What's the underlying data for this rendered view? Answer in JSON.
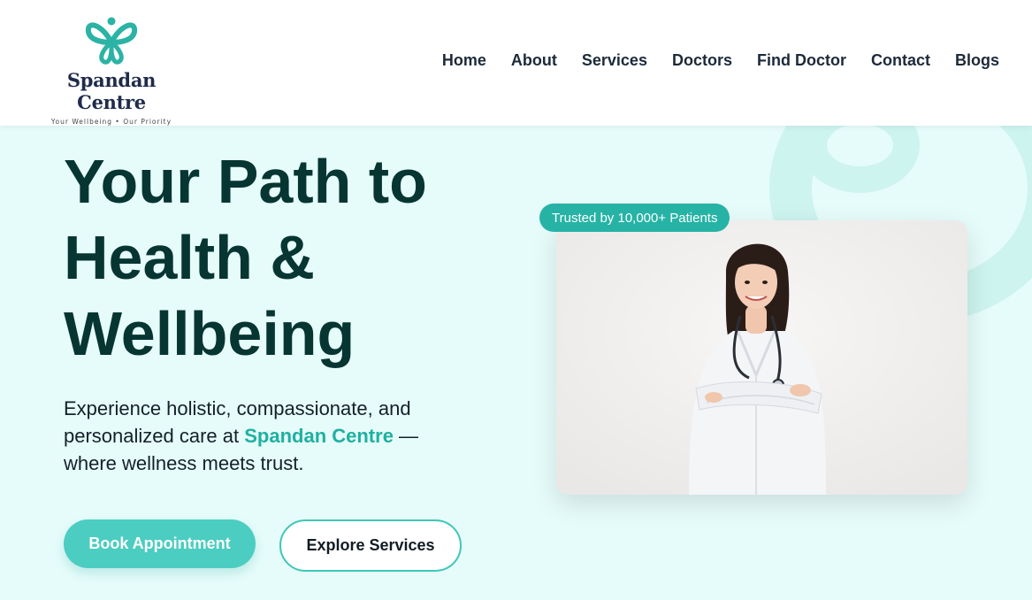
{
  "brand": {
    "name": "Spandan Centre",
    "tagline": "Your Wellbeing • Our Priority",
    "accent": "#26b3a5",
    "dark": "#063532"
  },
  "nav": {
    "items": [
      "Home",
      "About",
      "Services",
      "Doctors",
      "Find Doctor",
      "Contact",
      "Blogs"
    ]
  },
  "hero": {
    "title_line1": "Your Path to",
    "title_line2": "Health &",
    "title_line3": "Wellbeing",
    "desc_before": "Experience holistic, compassionate, and personalized care at ",
    "desc_brand": "Spandan Centre",
    "desc_after": " — where wellness meets trust.",
    "primary_button": "Book Appointment",
    "secondary_button": "Explore Services",
    "badge": "Trusted by 10,000+ Patients",
    "image_subject": "smiling-doctor-with-stethoscope"
  }
}
